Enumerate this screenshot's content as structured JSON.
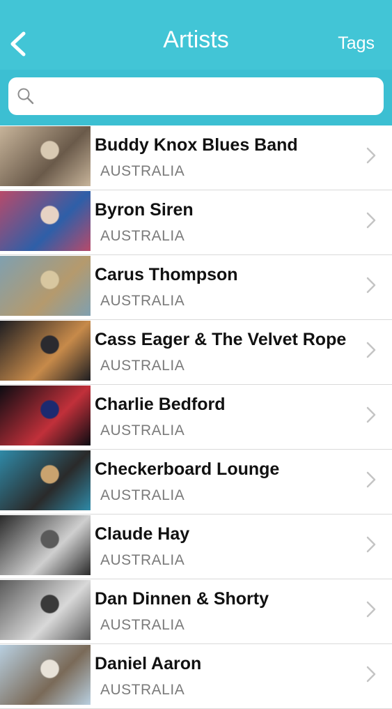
{
  "header": {
    "title": "Artists",
    "tags_label": "Tags",
    "back_icon": "chevron-left-icon",
    "background_color": "#42c5d6"
  },
  "search": {
    "placeholder": "",
    "value": "",
    "icon": "search-icon"
  },
  "artists": [
    {
      "name": "Buddy Knox Blues Band",
      "country": "AUSTRALIA",
      "photo_colors": [
        "#c7b49a",
        "#6a5a4a",
        "#d8c9b2"
      ]
    },
    {
      "name": "Byron Siren",
      "country": "AUSTRALIA",
      "photo_colors": [
        "#b84a6a",
        "#2e5fa8",
        "#e7d3c4"
      ]
    },
    {
      "name": "Carus Thompson",
      "country": "AUSTRALIA",
      "photo_colors": [
        "#7fa0b0",
        "#b59a6d",
        "#d8c7a0"
      ]
    },
    {
      "name": "Cass Eager & The Velvet Rope",
      "country": "AUSTRALIA",
      "photo_colors": [
        "#1e1e22",
        "#c78a4a",
        "#2b2a2f"
      ]
    },
    {
      "name": "Charlie Bedford",
      "country": "AUSTRALIA",
      "photo_colors": [
        "#0c0c12",
        "#c1303a",
        "#1c2a70"
      ]
    },
    {
      "name": "Checkerboard Lounge",
      "country": "AUSTRALIA",
      "photo_colors": [
        "#2f8aa8",
        "#2a2a2a",
        "#c9a36f"
      ]
    },
    {
      "name": "Claude Hay",
      "country": "AUSTRALIA",
      "photo_colors": [
        "#2a2a2a",
        "#cfcfcf",
        "#5a5a5a"
      ]
    },
    {
      "name": "Dan Dinnen & Shorty",
      "country": "AUSTRALIA",
      "photo_colors": [
        "#5a5a5a",
        "#d8d8d8",
        "#3a3a3a"
      ]
    },
    {
      "name": "Daniel Aaron",
      "country": "AUSTRALIA",
      "photo_colors": [
        "#b8cfe0",
        "#7a6a58",
        "#e8e2d8"
      ]
    }
  ]
}
